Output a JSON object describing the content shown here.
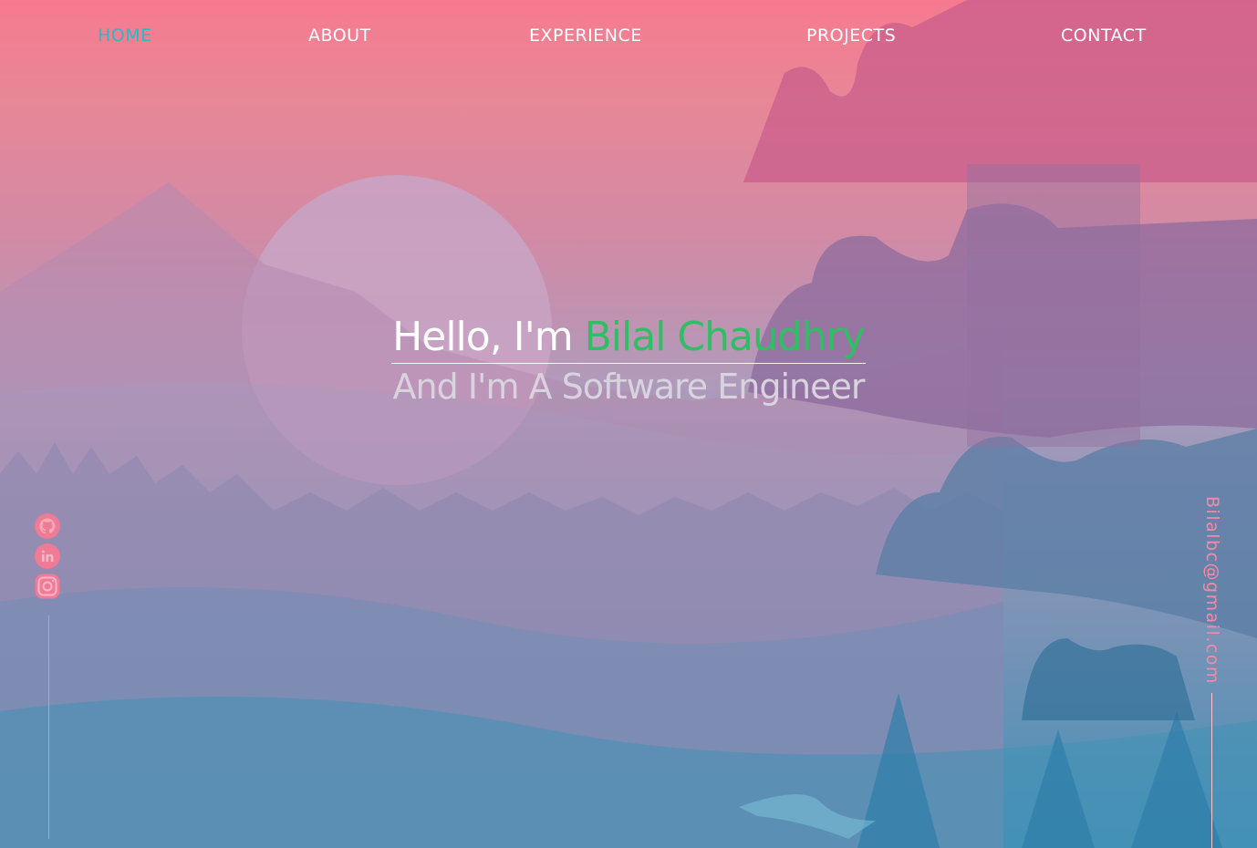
{
  "nav": {
    "items": [
      {
        "label": "HOME",
        "active": true
      },
      {
        "label": "ABOUT",
        "active": false
      },
      {
        "label": "EXPERIENCE",
        "active": false
      },
      {
        "label": "PROJECTS",
        "active": false
      },
      {
        "label": "CONTACT",
        "active": false
      }
    ]
  },
  "hero": {
    "greeting": "Hello, I'm ",
    "name": "Bilal Chaudhry",
    "subtitle": "And I'm A Software Engineer"
  },
  "social": [
    {
      "icon": "github-icon"
    },
    {
      "icon": "linkedin-icon"
    },
    {
      "icon": "instagram-icon"
    }
  ],
  "contact": {
    "email": "Bilalbc@gmail.com"
  },
  "colors": {
    "accent_active_nav": "#2bb9c4",
    "name_green": "#2fbe63",
    "social_pink": "#f07b96",
    "background_top": "#f77a8f",
    "background_bottom": "#1a8ab4"
  }
}
